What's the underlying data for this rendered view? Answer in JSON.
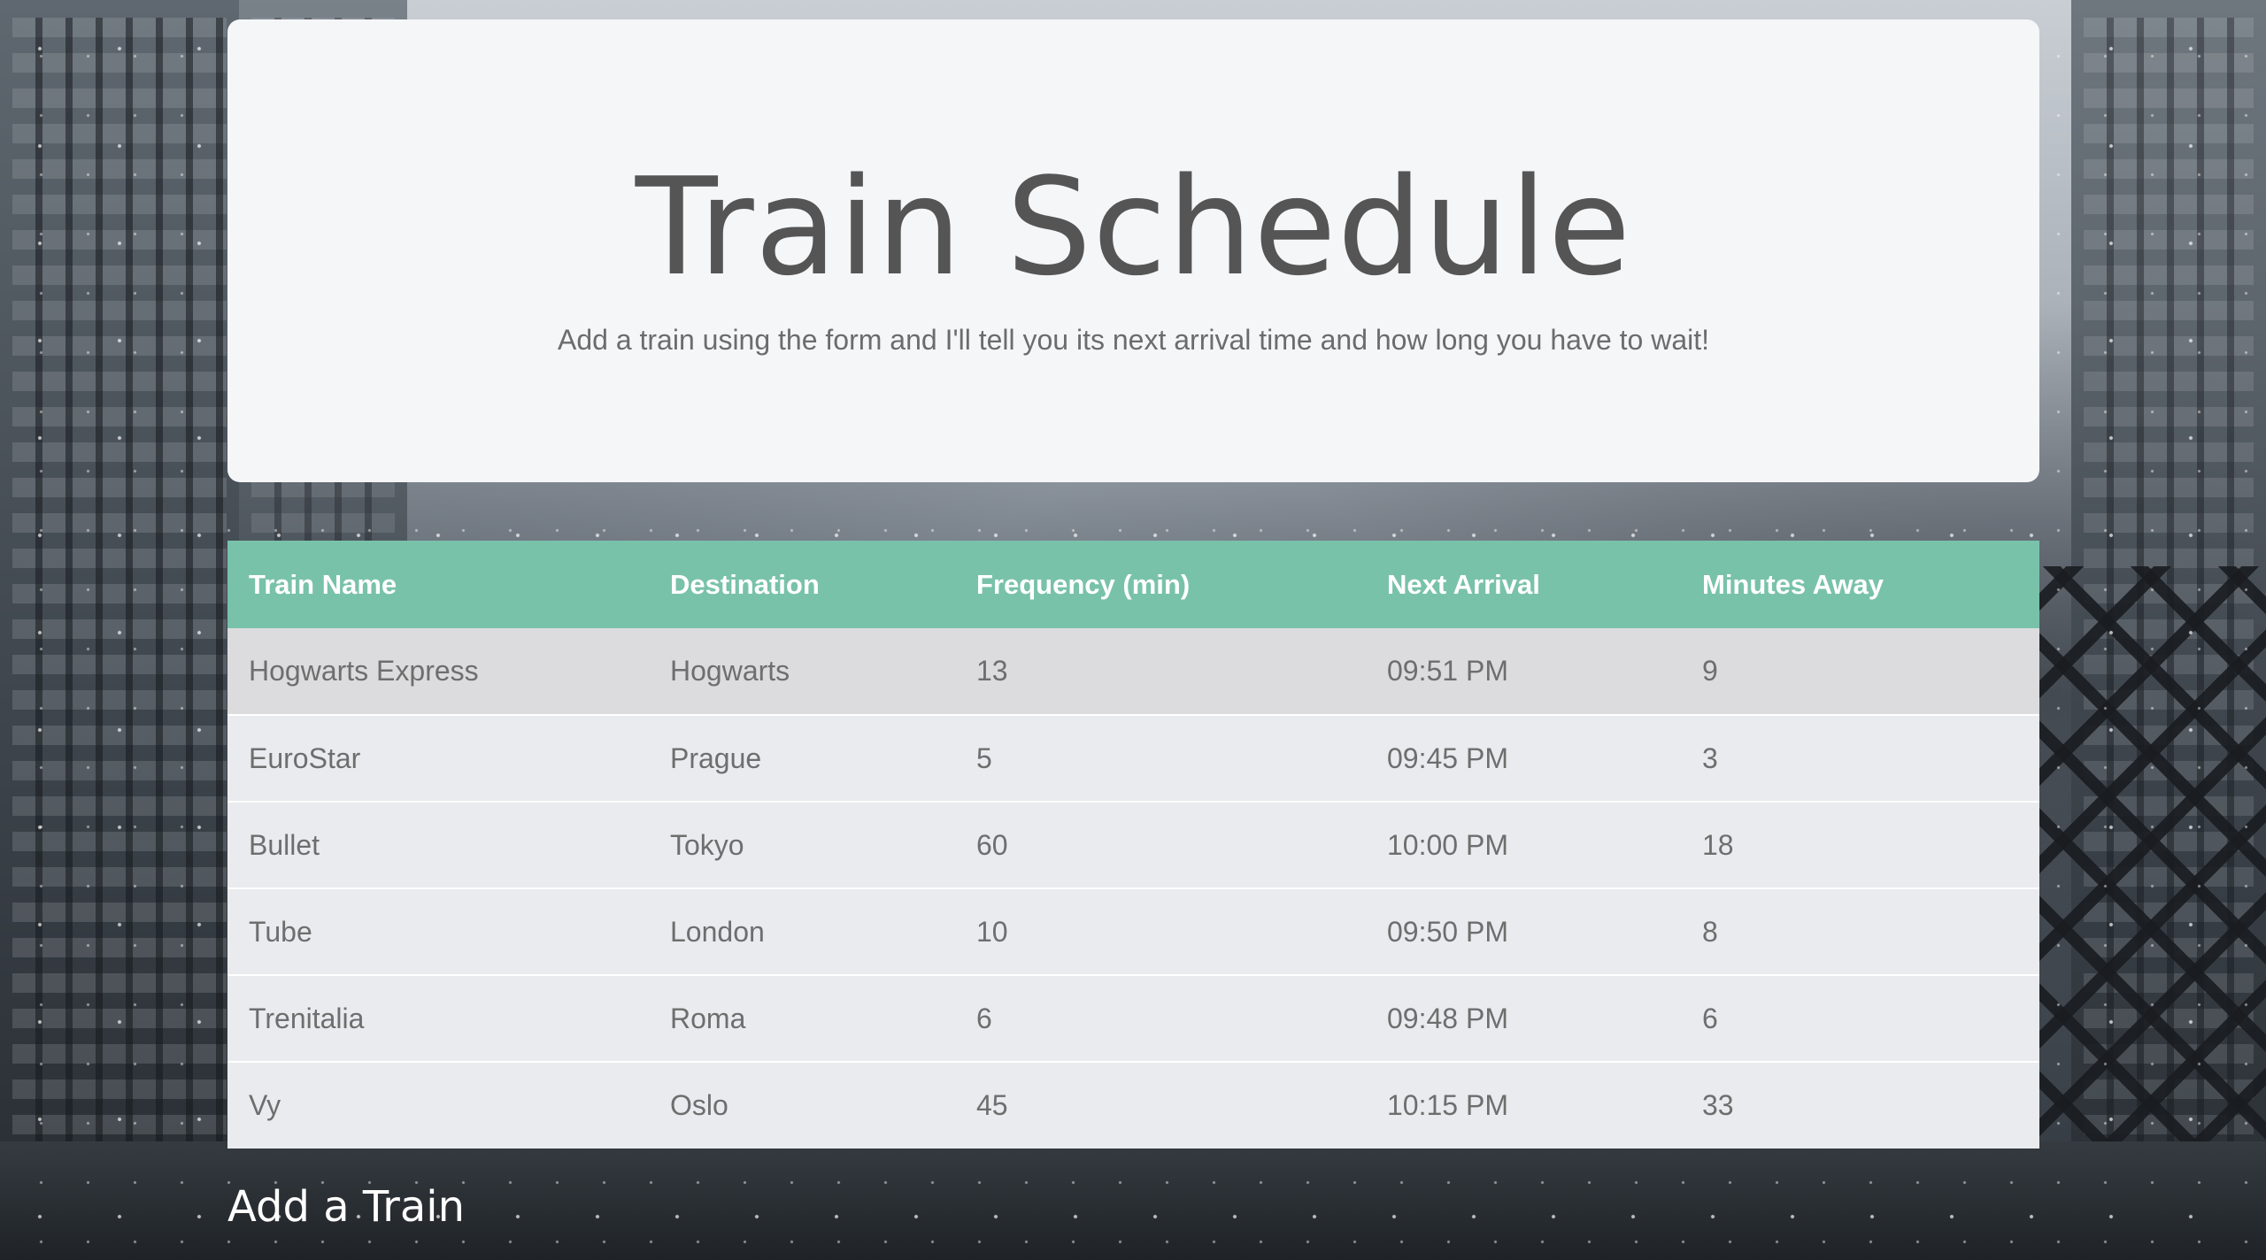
{
  "header": {
    "title": "Train Schedule",
    "subtitle": "Add a train using the form and I'll tell you its next arrival time and how long you have to wait!"
  },
  "table": {
    "columns": [
      "Train Name",
      "Destination",
      "Frequency (min)",
      "Next Arrival",
      "Minutes Away"
    ],
    "rows": [
      [
        "Hogwarts Express",
        "Hogwarts",
        "13",
        "09:51 PM",
        "9"
      ],
      [
        "EuroStar",
        "Prague",
        "5",
        "09:45 PM",
        "3"
      ],
      [
        "Bullet",
        "Tokyo",
        "60",
        "10:00 PM",
        "18"
      ],
      [
        "Tube",
        "London",
        "10",
        "09:50 PM",
        "8"
      ],
      [
        "Trenitalia",
        "Roma",
        "6",
        "09:48 PM",
        "6"
      ],
      [
        "Vy",
        "Oslo",
        "45",
        "10:15 PM",
        "33"
      ]
    ]
  },
  "form": {
    "heading": "Add a Train"
  },
  "colors": {
    "header_row": "#79c2aa",
    "jumbotron_bg": "#f5f6f8",
    "row_bg": "#e9ebee",
    "hover_row_bg": "#dcdcde"
  }
}
